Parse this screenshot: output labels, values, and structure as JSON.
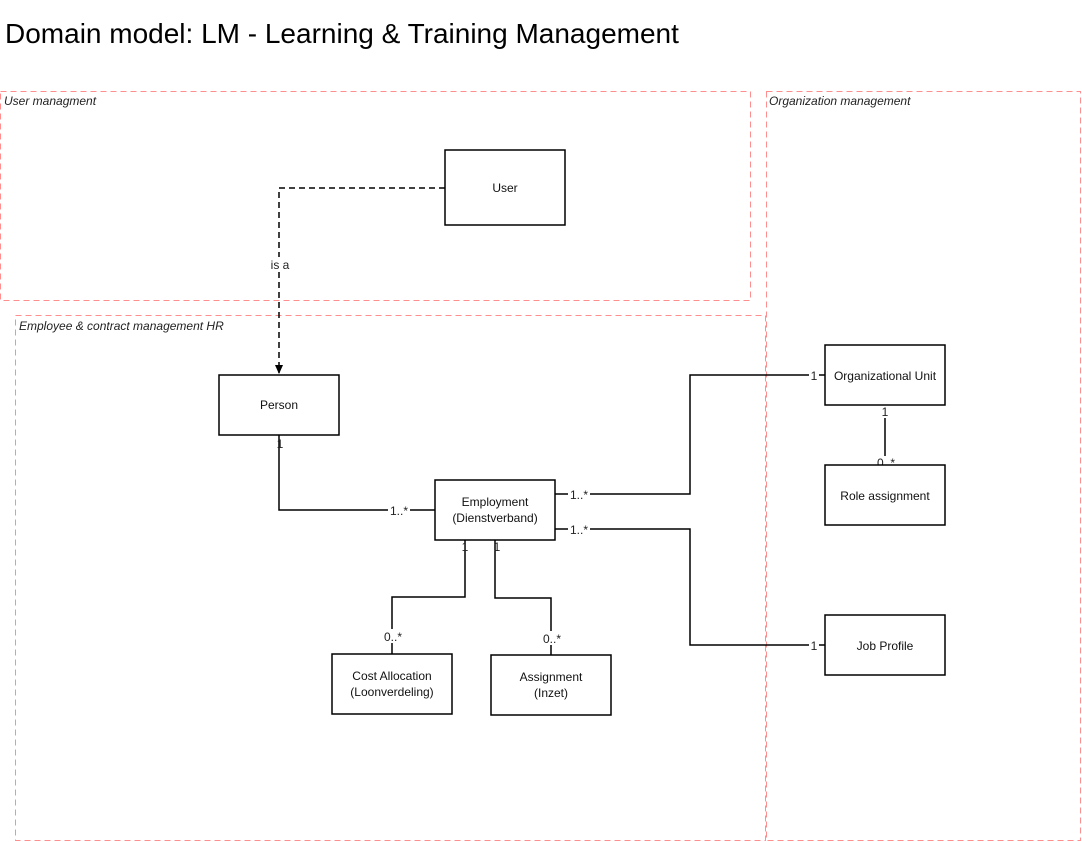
{
  "title": "Domain model: LM - Learning & Training Management",
  "colors": {
    "group_border": "#ff8f8f",
    "box_border": "#000000"
  },
  "groups": [
    {
      "label": "User managment"
    },
    {
      "label": "Organization management"
    },
    {
      "label": "Employee & contract management HR"
    }
  ],
  "entities": {
    "user": {
      "label": "User"
    },
    "person": {
      "label": "Person"
    },
    "employment": {
      "line1": "Employment",
      "line2": "(Dienstverband)"
    },
    "org_unit": {
      "label": "Organizational Unit"
    },
    "role_assignment": {
      "label": "Role assignment"
    },
    "job_profile": {
      "label": "Job Profile"
    },
    "cost_allocation": {
      "line1": "Cost Allocation",
      "line2": "(Loonverdeling)"
    },
    "assignment": {
      "line1": "Assignment",
      "line2": "(Inzet)"
    }
  },
  "relations": {
    "user_person": {
      "label": "is a"
    },
    "person_employment": {
      "source": "1",
      "target": "1..*"
    },
    "employment_orgunit": {
      "source": "1..*",
      "target": "1"
    },
    "employment_jobprofile": {
      "source": "1..*",
      "target": "1"
    },
    "orgunit_role": {
      "source": "1",
      "target": "0..*"
    },
    "employment_cost": {
      "source": "1",
      "target": "0..*"
    },
    "employment_assignment": {
      "source": "1",
      "target": "0..*"
    }
  }
}
